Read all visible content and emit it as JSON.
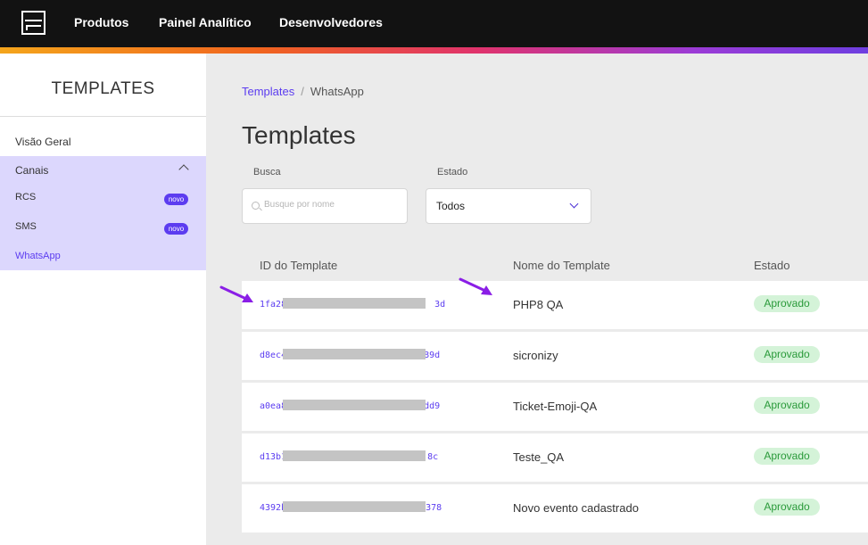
{
  "topnav": {
    "items": [
      "Produtos",
      "Painel Analítico",
      "Desenvolvedores"
    ]
  },
  "sidebar": {
    "title": "TEMPLATES",
    "overview": "Visão Geral",
    "channels_label": "Canais",
    "channels": [
      {
        "label": "RCS",
        "badge": "novo"
      },
      {
        "label": "SMS",
        "badge": "novo"
      },
      {
        "label": "WhatsApp",
        "badge": ""
      }
    ]
  },
  "breadcrumb": {
    "link": "Templates",
    "separator": "/",
    "current": "WhatsApp"
  },
  "page_title": "Templates",
  "filters": {
    "search_label": "Busca",
    "search_placeholder": "Busque por nome",
    "state_label": "Estado",
    "state_value": "Todos"
  },
  "table": {
    "headers": [
      "ID do Template",
      "Nome do Template",
      "Estado"
    ],
    "rows": [
      {
        "id_start": "1fa28",
        "id_end": "3d",
        "name": "PHP8 QA",
        "status": "Aprovado"
      },
      {
        "id_start": "d8ec4",
        "id_end": "789d",
        "name": "sicronizy",
        "status": "Aprovado"
      },
      {
        "id_start": "a0ea8",
        "id_end": "dd9",
        "name": "Ticket-Emoji-QA",
        "status": "Aprovado"
      },
      {
        "id_start": "d13b1",
        "id_end": "8c",
        "name": "Teste_QA",
        "status": "Aprovado"
      },
      {
        "id_start": "4392b",
        "id_end": "378",
        "name": "Novo evento cadastrado",
        "status": "Aprovado"
      }
    ]
  },
  "colors": {
    "accent": "#5b3cf0",
    "sidebar_active": "#dcd7fd",
    "annotation_arrow": "#8a1ee6",
    "status_bg": "#d4f3d8",
    "status_text": "#2a9a3a"
  }
}
